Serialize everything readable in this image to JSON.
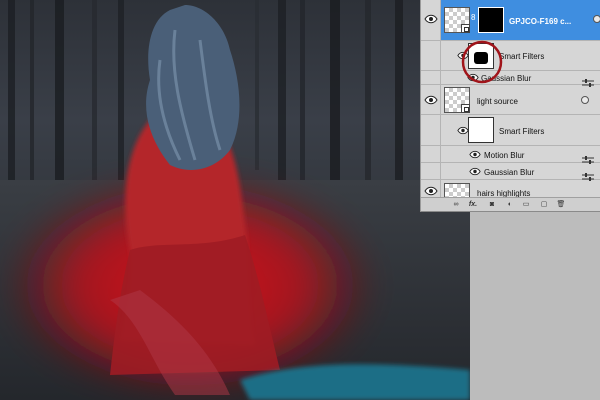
{
  "layers_panel": {
    "layers": [
      {
        "name": "GPJCO-F169 c...",
        "selected": true
      },
      {
        "name": "light source",
        "selected": false
      },
      {
        "name": "hairs highlights",
        "selected": false
      }
    ],
    "filters_group_1": {
      "title": "Smart Filters",
      "items": [
        "Gaussian Blur"
      ]
    },
    "filters_group_2": {
      "title": "Smart Filters",
      "items": [
        "Motion Blur",
        "Gaussian Blur"
      ]
    },
    "toolbar_fx": "fx."
  },
  "colors": {
    "selection": "#3f8ee0",
    "panel_bg": "#d6d6d6",
    "red_glow": "#e0141c",
    "annotation_circle": "#a0141a"
  },
  "icons": [
    "eye-icon",
    "link-icon",
    "smart-object-icon",
    "filter-options-icon",
    "fx-icon",
    "mask-icon",
    "adjustment-icon",
    "group-icon",
    "new-layer-icon",
    "trash-icon"
  ]
}
